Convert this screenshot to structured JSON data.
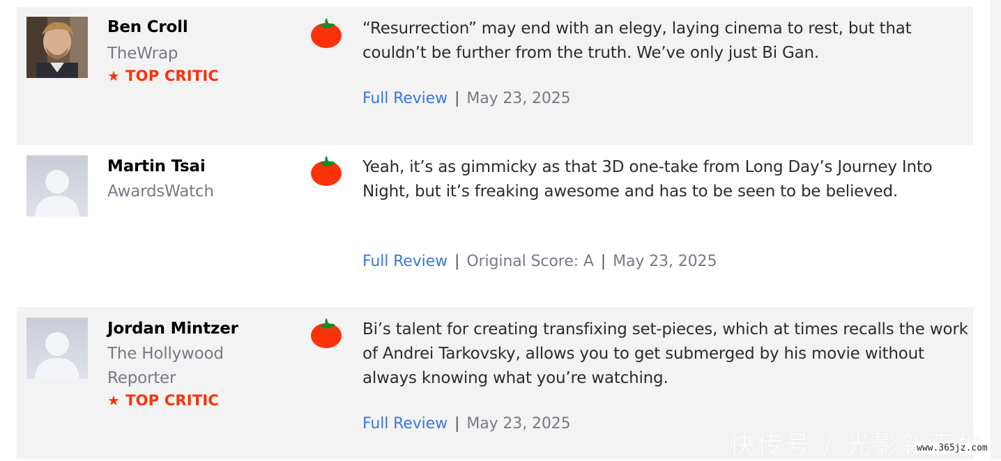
{
  "reviews": [
    {
      "critic": "Ben Croll",
      "publication": "TheWrap",
      "top_critic_label": "TOP CRITIC",
      "quote": "“Resurrection” may end with an elegy, laying cinema to rest, but that couldn’t be further from the truth. We’ve only just Bi Gan.",
      "full_review_label": "Full Review",
      "original_score": "",
      "date": "May 23, 2025",
      "avatar": "photo",
      "rating_icon": "fresh-tomato-icon"
    },
    {
      "critic": "Martin Tsai",
      "publication": "AwardsWatch",
      "top_critic_label": "",
      "quote": "Yeah, it’s as gimmicky as that 3D one-take from Long Day’s Journey Into Night, but it’s freaking awesome and has to be seen to be believed.",
      "full_review_label": "Full Review",
      "original_score": "Original Score: A",
      "date": "May 23, 2025",
      "avatar": "placeholder",
      "rating_icon": "fresh-tomato-icon"
    },
    {
      "critic": "Jordan Mintzer",
      "publication": "The Hollywood Reporter",
      "top_critic_label": "TOP CRITIC",
      "quote": "Bi’s talent for creating transfixing set-pieces, which at times recalls the work of Andrei Tarkovsky, allows you to get submerged by his movie without always knowing what you’re watching.",
      "full_review_label": "Full Review",
      "original_score": "",
      "date": "May 23, 2025",
      "avatar": "placeholder",
      "rating_icon": "fresh-tomato-icon"
    }
  ],
  "separator": "|",
  "watermark": {
    "text": "快传号 / 光影新天地",
    "url": "www.365jz.com"
  },
  "colors": {
    "row_background": "#f3f3f3",
    "top_critic": "#fa320a",
    "link": "#3976dc",
    "muted": "#757a84"
  }
}
